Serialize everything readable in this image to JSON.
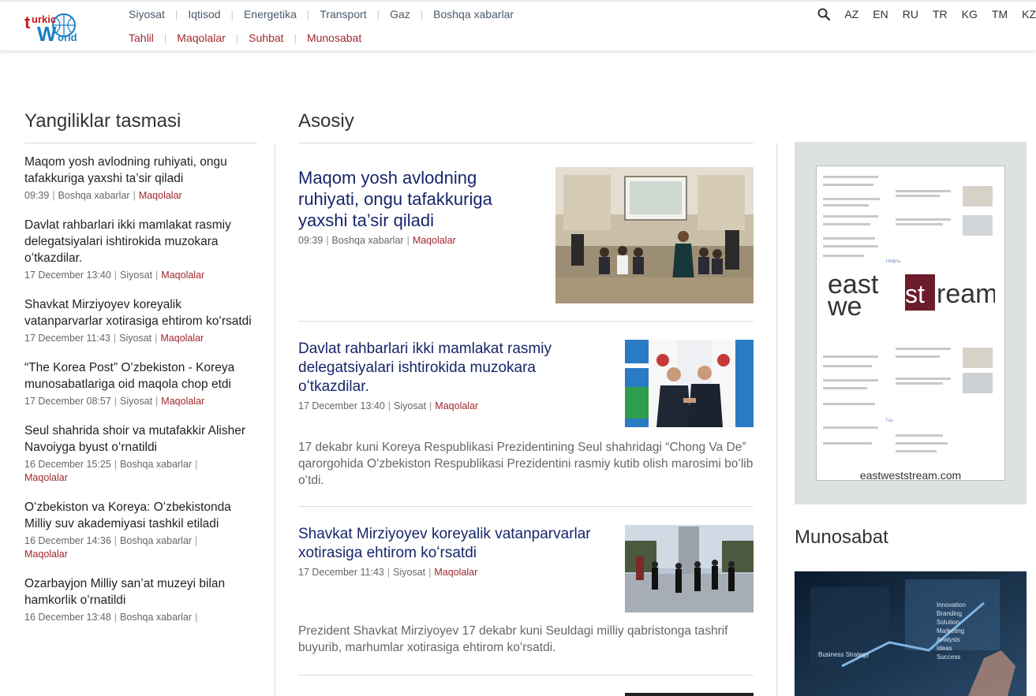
{
  "header": {
    "logo_text": "turkic world",
    "nav_primary": [
      "Siyosat",
      "Iqtisod",
      "Energetika",
      "Transport",
      "Gaz",
      "Boshqa xabarlar"
    ],
    "nav_secondary": [
      "Tahlil",
      "Maqolalar",
      "Suhbat",
      "Munosabat"
    ],
    "languages": [
      "AZ",
      "EN",
      "RU",
      "TR",
      "KG",
      "TM",
      "KZ"
    ],
    "search_icon": "search-icon"
  },
  "feed": {
    "title": "Yangiliklar tasmasi",
    "items": [
      {
        "title": "Maqom yosh avlodning ruhiyati, ongu tafakkuriga yaxshi ta’sir qiladi",
        "time": "09:39",
        "category": "Boshqa xabarlar",
        "tag": "Maqolalar"
      },
      {
        "title": "Davlat rahbarlari ikki mamlakat rasmiy delegatsiyalari ishtirokida muzokara oʻtkazdilar.",
        "time": "17 December 13:40",
        "category": "Siyosat",
        "tag": "Maqolalar"
      },
      {
        "title": "Shavkat Mirziyoyev koreyalik vatanparvarlar xotirasiga ehtirom koʻrsatdi",
        "time": "17 December 11:43",
        "category": "Siyosat",
        "tag": "Maqolalar"
      },
      {
        "title": "“The Korea Post” Oʻzbekiston - Koreya munosabatlariga oid maqola chop etdi",
        "time": "17 December 08:57",
        "category": "Siyosat",
        "tag": "Maqolalar"
      },
      {
        "title": "Seul shahrida shoir va mutafakkir Alisher Navoiyga byust oʻrnatildi",
        "time": "16 December 15:25",
        "category": "Boshqa xabarlar",
        "tag": "Maqolalar"
      },
      {
        "title": "Oʻzbekiston va Koreya: Oʻzbekistonda Milliy suv akademiyasi tashkil etiladi",
        "time": "16 December 14:36",
        "category": "Boshqa xabarlar",
        "tag": "Maqolalar"
      },
      {
        "title": "Ozarbayjon Milliy san’at muzeyi bilan hamkorlik oʻrnatildi",
        "time": "16 December 13:48",
        "category": "Boshqa xabarlar",
        "tag": ""
      }
    ]
  },
  "main": {
    "title": "Asosiy",
    "articles": [
      {
        "title": "Maqom yosh avlodning ruhiyati, ongu tafakkuriga yaxshi ta’sir qiladi",
        "time": "09:39",
        "category": "Boshqa xabarlar",
        "tag": "Maqolalar",
        "excerpt": ""
      },
      {
        "title": "Davlat rahbarlari ikki mamlakat rasmiy delegatsiyalari ishtirokida muzokara oʻtkazdilar.",
        "time": "17 December 13:40",
        "category": "Siyosat",
        "tag": "Maqolalar",
        "excerpt": "17 dekabr kuni Koreya Respublikasi Prezidentining Seul shahridagi “Chong Va De” qarorgohida Oʻzbekiston Respublikasi Prezidentini rasmiy kutib olish marosimi boʻlib oʻtdi."
      },
      {
        "title": "Shavkat Mirziyoyev koreyalik vatanparvarlar xotirasiga ehtirom koʻrsatdi",
        "time": "17 December 11:43",
        "category": "Siyosat",
        "tag": "Maqolalar",
        "excerpt": "Prezident Shavkat Mirziyoyev 17 dekabr kuni Seuldagi milliy qabristonga tashrif buyurib, marhumlar xotirasiga ehtirom koʻrsatdi."
      }
    ]
  },
  "sidebar": {
    "ad": {
      "url": "eastweststream.com",
      "logo_top": "east",
      "logo_mid": "st",
      "logo_bottom": "we",
      "logo_right": "ream"
    },
    "section_title": "Munosabat"
  },
  "colors": {
    "accent_red": "#a0282e",
    "headline_navy": "#172569",
    "nav_gray": "#4a5a6a"
  }
}
